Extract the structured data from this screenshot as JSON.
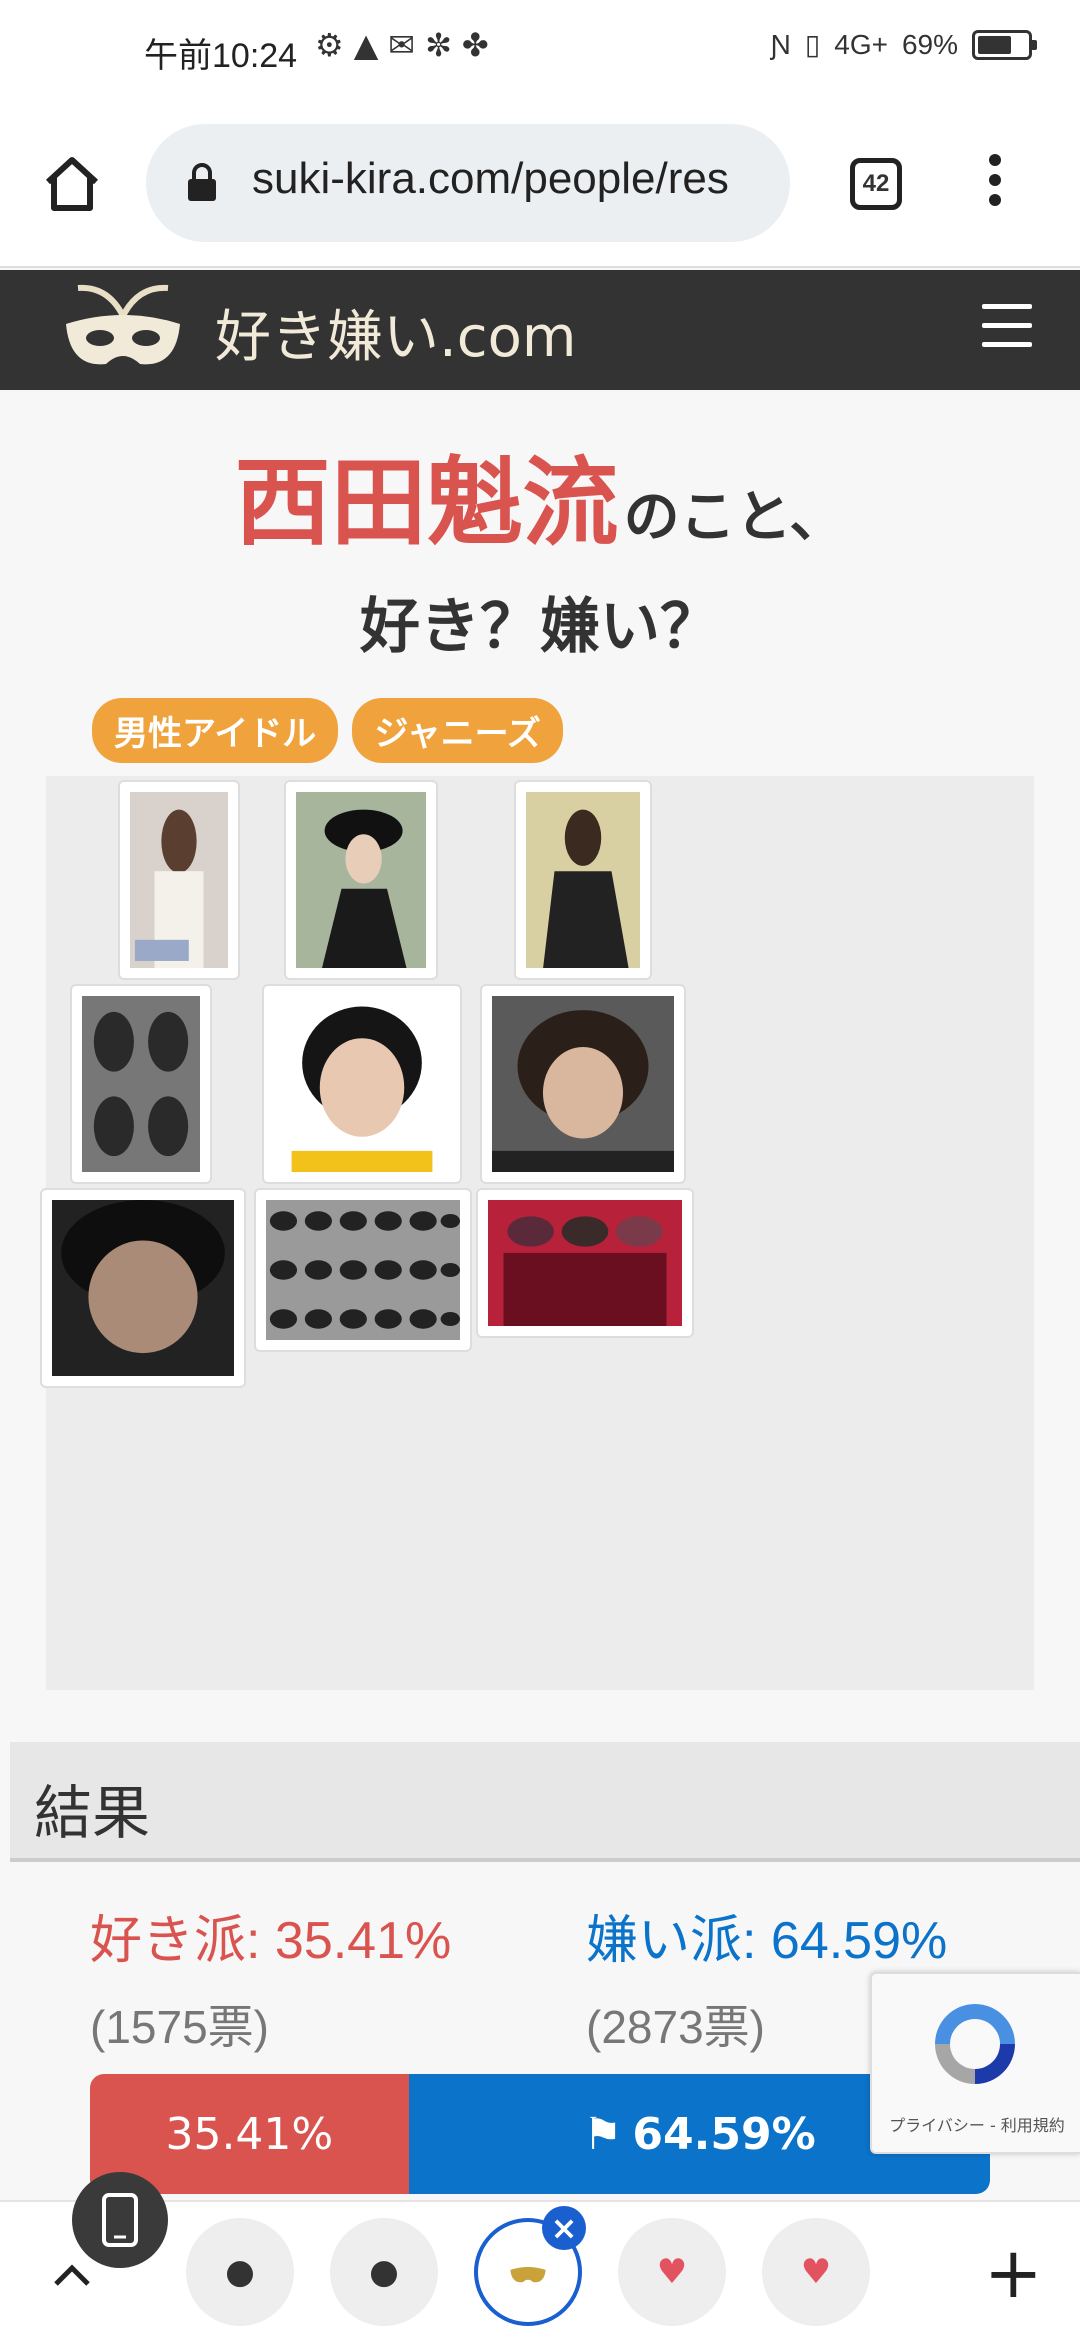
{
  "status_bar": {
    "time": "午前10:24",
    "network": "4G+",
    "battery": "69%",
    "battery_level": 0.69
  },
  "browser": {
    "url": "suki-kira.com/people/res",
    "tab_count": "42"
  },
  "site": {
    "name": "好き嫌い.com"
  },
  "title": {
    "name": "西田魁流",
    "suffix": "のこと、",
    "question": "好き？嫌い？"
  },
  "tags": [
    "男性アイドル",
    "ジャニーズ"
  ],
  "results": {
    "heading": "結果",
    "like_label": "好き派: 35.41%",
    "like_votes": "(1575票)",
    "dislike_label": "嫌い派: 64.59%",
    "dislike_votes": "(2873票)",
    "like_bar_text": "35.41%",
    "dislike_bar_text": "64.59%",
    "like_fraction": 0.3541
  },
  "recaptcha": {
    "text": "プライバシー - 利用規約"
  },
  "colors": {
    "like": "#d9534f",
    "dislike": "#0b73c9",
    "tag": "#f0a33c",
    "header": "#333333"
  }
}
